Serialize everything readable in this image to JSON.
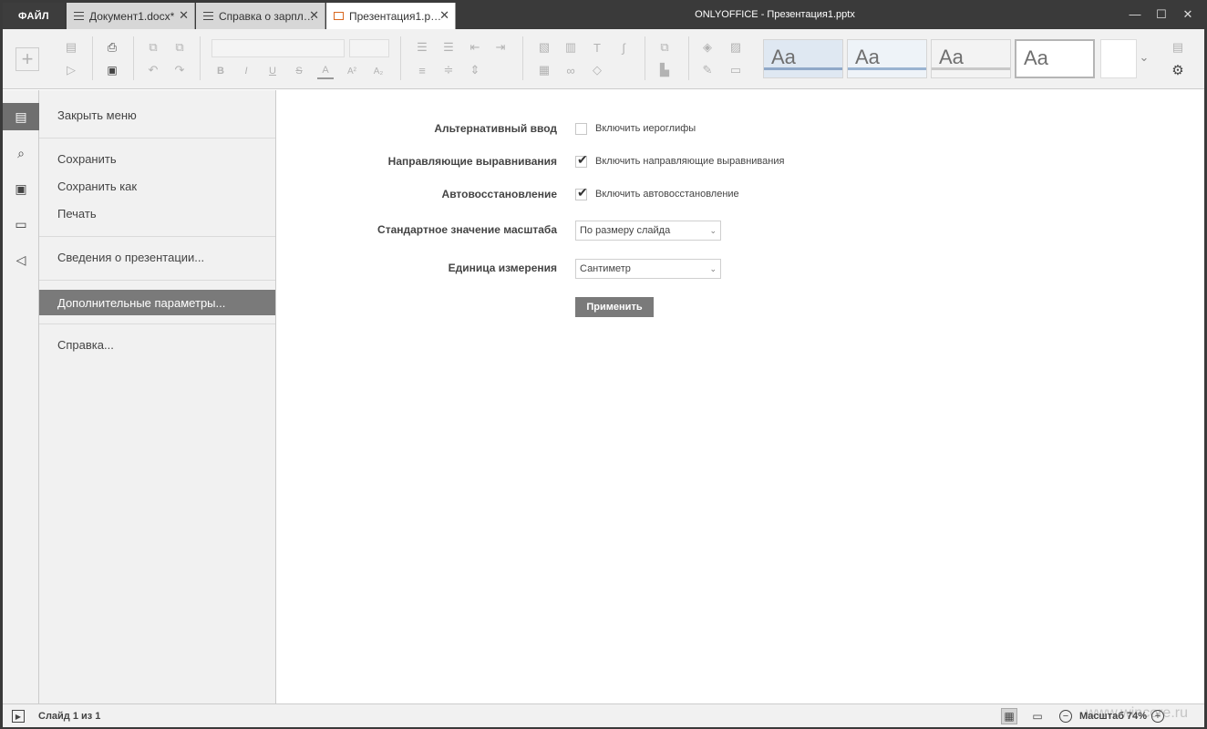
{
  "window": {
    "title": "ONLYOFFICE - Презентация1.pptx",
    "minimize": "—",
    "maximize": "☐",
    "close": "✕"
  },
  "file_button": "ФАЙЛ",
  "tabs": [
    {
      "label": "Документ1.docx*",
      "icon": "document-icon",
      "close": "✕"
    },
    {
      "label": "Справка о зарпл…",
      "icon": "document-icon",
      "close": "✕"
    },
    {
      "label": "Презентация1.p…",
      "icon": "presentation-icon",
      "close": "✕",
      "active": true
    }
  ],
  "toolbar": {
    "themes": [
      {
        "label": "Aa",
        "accent": "#8fa8c8"
      },
      {
        "label": "Aa",
        "accent": "#9ab3d1"
      },
      {
        "label": "Aa",
        "accent": "#c8c8c8"
      },
      {
        "label": "Aa",
        "accent": "#ffffff"
      }
    ],
    "icons": {
      "add": "+",
      "print": "⎙",
      "save": "💾",
      "bold": "B",
      "italic": "I",
      "underline": "U",
      "strike": "S",
      "font_color": "A",
      "superscript": "A²",
      "subscript": "A₂",
      "expand": "⌄",
      "settings": "⚙"
    }
  },
  "left_strip": {
    "items": [
      "file-icon",
      "search-icon",
      "slides-icon",
      "comments-icon",
      "speaker-icon"
    ]
  },
  "file_menu": {
    "close_menu": "Закрыть меню",
    "save": "Сохранить",
    "save_as": "Сохранить как",
    "print": "Печать",
    "info": "Сведения о презентации...",
    "advanced": "Дополнительные параметры...",
    "help": "Справка..."
  },
  "settings": {
    "alt_input_label": "Альтернативный ввод",
    "alt_input_check": "Включить иероглифы",
    "alt_input_checked": false,
    "guides_label": "Направляющие выравнивания",
    "guides_check": "Включить направляющие выравнивания",
    "guides_checked": true,
    "autorecover_label": "Автовосстановление",
    "autorecover_check": "Включить автовосстановление",
    "autorecover_checked": true,
    "zoom_label": "Стандартное значение масштаба",
    "zoom_value": "По размеру слайда",
    "unit_label": "Единица измерения",
    "unit_value": "Сантиметр",
    "apply": "Применить"
  },
  "status": {
    "slide_info": "Слайд 1 из 1",
    "zoom": "Масштаб 74%",
    "watermark": "www.wincore.ru"
  }
}
